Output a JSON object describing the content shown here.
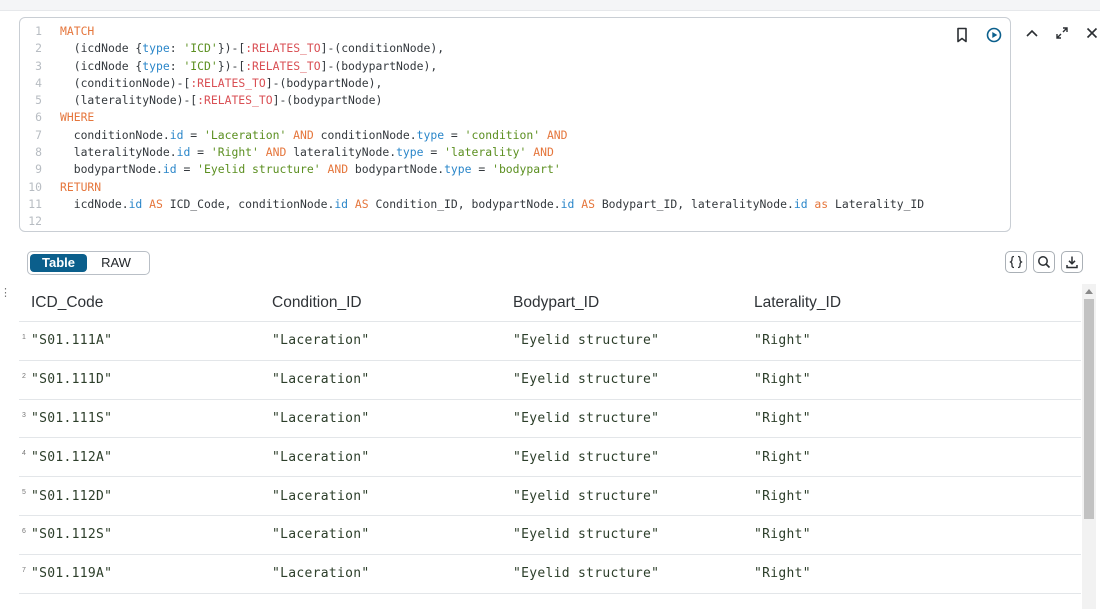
{
  "editor": {
    "lines": [
      {
        "n": "1",
        "tokens": [
          {
            "t": "MATCH",
            "c": "kw"
          }
        ]
      },
      {
        "n": "2",
        "tokens": [
          {
            "t": "  (icdNode {",
            "c": "plain"
          },
          {
            "t": "type",
            "c": "prop"
          },
          {
            "t": ": ",
            "c": "plain"
          },
          {
            "t": "'ICD'",
            "c": "str"
          },
          {
            "t": "})-[",
            "c": "plain"
          },
          {
            "t": ":RELATES_TO",
            "c": "rel"
          },
          {
            "t": "]-(conditionNode),",
            "c": "plain"
          }
        ]
      },
      {
        "n": "3",
        "tokens": [
          {
            "t": "  (icdNode {",
            "c": "plain"
          },
          {
            "t": "type",
            "c": "prop"
          },
          {
            "t": ": ",
            "c": "plain"
          },
          {
            "t": "'ICD'",
            "c": "str"
          },
          {
            "t": "})-[",
            "c": "plain"
          },
          {
            "t": ":RELATES_TO",
            "c": "rel"
          },
          {
            "t": "]-(bodypartNode),",
            "c": "plain"
          }
        ]
      },
      {
        "n": "4",
        "tokens": [
          {
            "t": "  (conditionNode)-[",
            "c": "plain"
          },
          {
            "t": ":RELATES_TO",
            "c": "rel"
          },
          {
            "t": "]-(bodypartNode),",
            "c": "plain"
          }
        ]
      },
      {
        "n": "5",
        "tokens": [
          {
            "t": "  (lateralityNode)-[",
            "c": "plain"
          },
          {
            "t": ":RELATES_TO",
            "c": "rel"
          },
          {
            "t": "]-(bodypartNode)",
            "c": "plain"
          }
        ]
      },
      {
        "n": "6",
        "tokens": [
          {
            "t": "WHERE",
            "c": "kw"
          }
        ]
      },
      {
        "n": "7",
        "tokens": [
          {
            "t": "  conditionNode.",
            "c": "plain"
          },
          {
            "t": "id",
            "c": "prop"
          },
          {
            "t": " = ",
            "c": "plain"
          },
          {
            "t": "'Laceration'",
            "c": "str"
          },
          {
            "t": " AND ",
            "c": "kw"
          },
          {
            "t": "conditionNode.",
            "c": "plain"
          },
          {
            "t": "type",
            "c": "prop"
          },
          {
            "t": " = ",
            "c": "plain"
          },
          {
            "t": "'condition'",
            "c": "str"
          },
          {
            "t": " AND",
            "c": "kw"
          }
        ]
      },
      {
        "n": "8",
        "tokens": [
          {
            "t": "  lateralityNode.",
            "c": "plain"
          },
          {
            "t": "id",
            "c": "prop"
          },
          {
            "t": " = ",
            "c": "plain"
          },
          {
            "t": "'Right'",
            "c": "str"
          },
          {
            "t": " AND ",
            "c": "kw"
          },
          {
            "t": "lateralityNode.",
            "c": "plain"
          },
          {
            "t": "type",
            "c": "prop"
          },
          {
            "t": " = ",
            "c": "plain"
          },
          {
            "t": "'laterality'",
            "c": "str"
          },
          {
            "t": " AND",
            "c": "kw"
          }
        ]
      },
      {
        "n": "9",
        "tokens": [
          {
            "t": "  bodypartNode.",
            "c": "plain"
          },
          {
            "t": "id",
            "c": "prop"
          },
          {
            "t": " = ",
            "c": "plain"
          },
          {
            "t": "'Eyelid structure'",
            "c": "str"
          },
          {
            "t": " AND ",
            "c": "kw"
          },
          {
            "t": "bodypartNode.",
            "c": "plain"
          },
          {
            "t": "type",
            "c": "prop"
          },
          {
            "t": " = ",
            "c": "plain"
          },
          {
            "t": "'bodypart'",
            "c": "str"
          }
        ]
      },
      {
        "n": "10",
        "tokens": [
          {
            "t": "RETURN",
            "c": "kw"
          }
        ]
      },
      {
        "n": "11",
        "tokens": [
          {
            "t": "  icdNode.",
            "c": "plain"
          },
          {
            "t": "id",
            "c": "prop"
          },
          {
            "t": " AS ",
            "c": "kw"
          },
          {
            "t": "ICD_Code, conditionNode.",
            "c": "plain"
          },
          {
            "t": "id",
            "c": "prop"
          },
          {
            "t": " AS ",
            "c": "kw"
          },
          {
            "t": "Condition_ID, bodypartNode.",
            "c": "plain"
          },
          {
            "t": "id",
            "c": "prop"
          },
          {
            "t": " AS ",
            "c": "kw"
          },
          {
            "t": "Bodypart_ID, lateralityNode.",
            "c": "plain"
          },
          {
            "t": "id",
            "c": "prop"
          },
          {
            "t": " as ",
            "c": "kw"
          },
          {
            "t": "Laterality_ID",
            "c": "plain"
          }
        ]
      },
      {
        "n": "12",
        "tokens": []
      }
    ],
    "icons": [
      "bookmark-icon",
      "run-icon"
    ]
  },
  "window_icons": [
    "collapse-icon",
    "expand-icon",
    "close-icon"
  ],
  "view_toggle": {
    "table_label": "Table",
    "raw_label": "RAW",
    "selected": "Table"
  },
  "result_icons": [
    "json-icon",
    "search-icon",
    "download-icon"
  ],
  "colors": {
    "accent": "#0b5f8c",
    "keyword": "#e5763c",
    "property": "#2a86c9",
    "string": "#5b8f20",
    "relationship": "#d94f54"
  },
  "table": {
    "columns": [
      "ICD_Code",
      "Condition_ID",
      "Bodypart_ID",
      "Laterality_ID"
    ],
    "rows": [
      {
        "n": "1",
        "cells": [
          "\"S01.111A\"",
          "\"Laceration\"",
          "\"Eyelid structure\"",
          "\"Right\""
        ]
      },
      {
        "n": "2",
        "cells": [
          "\"S01.111D\"",
          "\"Laceration\"",
          "\"Eyelid structure\"",
          "\"Right\""
        ]
      },
      {
        "n": "3",
        "cells": [
          "\"S01.111S\"",
          "\"Laceration\"",
          "\"Eyelid structure\"",
          "\"Right\""
        ]
      },
      {
        "n": "4",
        "cells": [
          "\"S01.112A\"",
          "\"Laceration\"",
          "\"Eyelid structure\"",
          "\"Right\""
        ]
      },
      {
        "n": "5",
        "cells": [
          "\"S01.112D\"",
          "\"Laceration\"",
          "\"Eyelid structure\"",
          "\"Right\""
        ]
      },
      {
        "n": "6",
        "cells": [
          "\"S01.112S\"",
          "\"Laceration\"",
          "\"Eyelid structure\"",
          "\"Right\""
        ]
      },
      {
        "n": "7",
        "cells": [
          "\"S01.119A\"",
          "\"Laceration\"",
          "\"Eyelid structure\"",
          "\"Right\""
        ]
      }
    ]
  }
}
